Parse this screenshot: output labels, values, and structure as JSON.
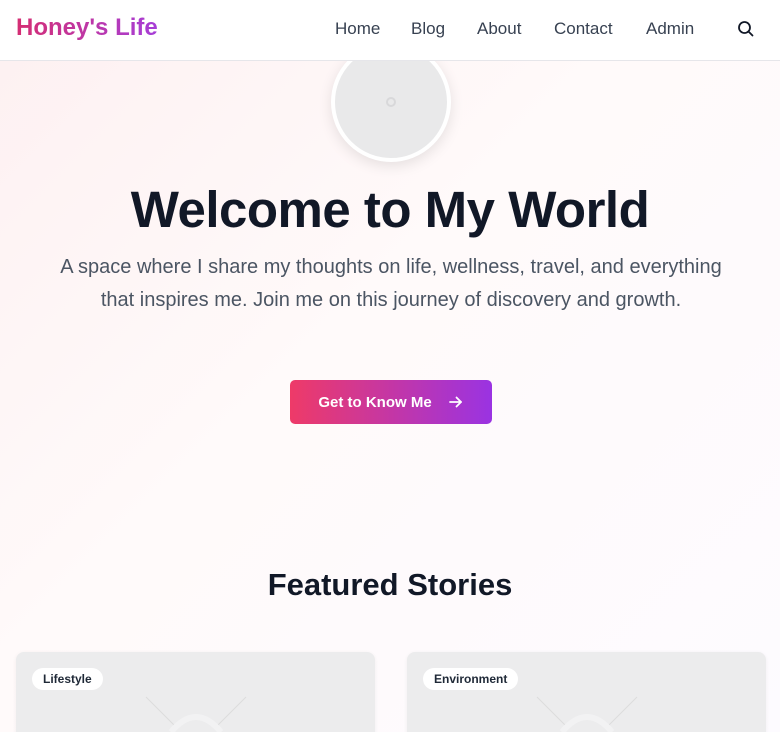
{
  "site": {
    "logo": "Honey's Life"
  },
  "nav": {
    "links": [
      {
        "label": "Home"
      },
      {
        "label": "Blog"
      },
      {
        "label": "About"
      },
      {
        "label": "Contact"
      },
      {
        "label": "Admin"
      }
    ],
    "search_icon": "search-icon"
  },
  "hero": {
    "title": "Welcome to My World",
    "subtitle": "A space where I share my thoughts on life, wellness, travel, and everything that inspires me. Join me on this journey of discovery and growth.",
    "cta_label": "Get to Know Me",
    "cta_icon": "arrow-right-icon"
  },
  "featured": {
    "title": "Featured Stories",
    "cards": [
      {
        "category": "Lifestyle"
      },
      {
        "category": "Environment"
      }
    ]
  },
  "colors": {
    "brand_start": "#d52e73",
    "brand_end": "#a63ed8",
    "cta_start": "#ee3a68",
    "cta_end": "#9a33e2",
    "heading": "#111827",
    "body_text": "#4b5563"
  }
}
